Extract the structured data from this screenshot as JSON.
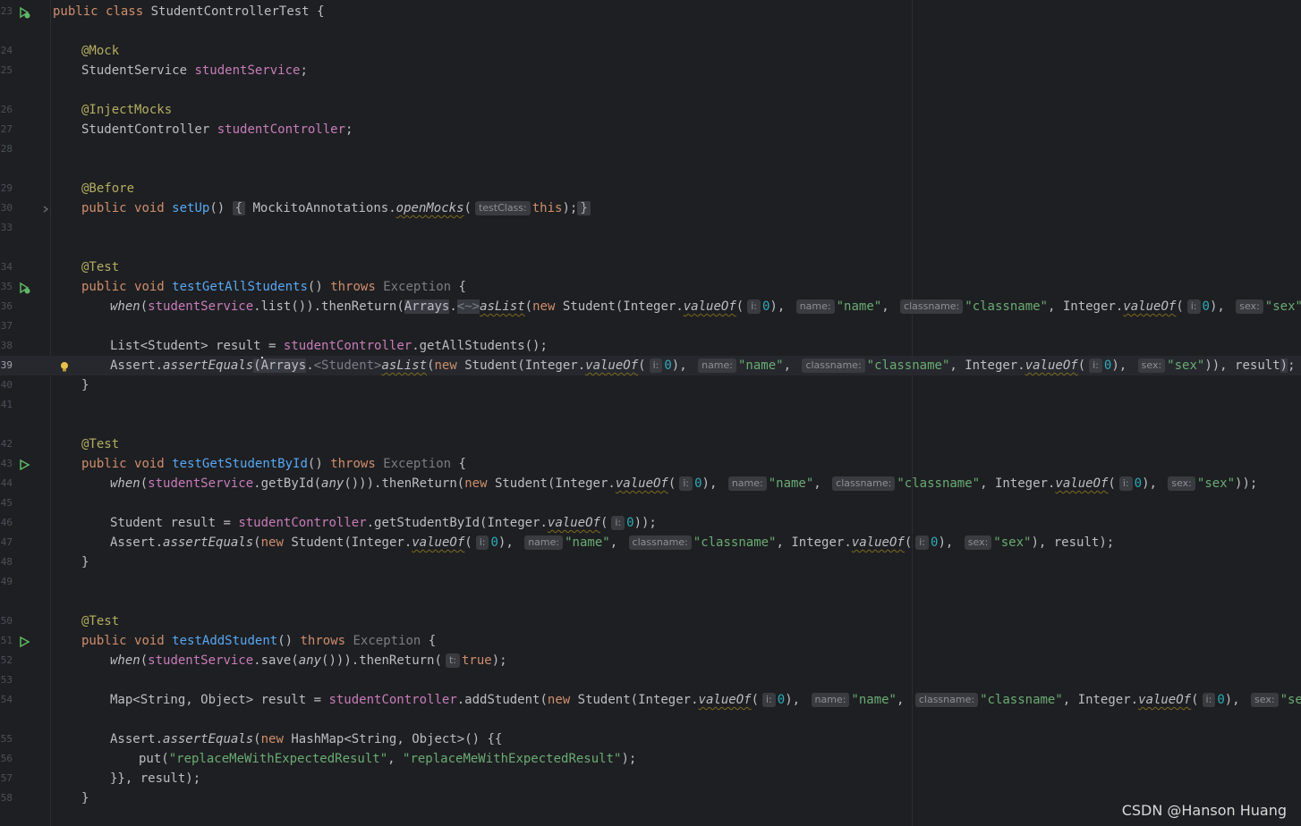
{
  "line_numbers": {
    "l23": "23",
    "l24": "24",
    "l25": "25",
    "l26": "26",
    "l27": "27",
    "l28": "28",
    "l29": "29",
    "l30": "30",
    "l33": "33",
    "l34": "34",
    "l35": "35",
    "l36": "36",
    "l37": "37",
    "l38": "38",
    "l39": "39",
    "l40": "40",
    "l41": "41",
    "l42": "42",
    "l43": "43",
    "l44": "44",
    "l45": "45",
    "l46": "46",
    "l47": "47",
    "l48": "48",
    "l49": "49",
    "l50": "50",
    "l51": "51",
    "l52": "52",
    "l53": "53",
    "l54": "54",
    "l55": "55",
    "l56": "56",
    "l57": "57",
    "l58": "58"
  },
  "words": {
    "public": "public",
    "class": "class",
    "void": "void",
    "new": "new",
    "throws": "throws",
    "this": "this",
    "true": "true",
    "zero": "0",
    "lbrace": "{",
    "rbrace": "}",
    "semi": ";",
    "StudentService": "StudentService",
    "StudentController": "StudentController",
    "studentService": "studentService",
    "studentController": "studentController",
    "Student": "Student",
    "Integer": "Integer",
    "valueOf": "valueOf",
    "Exception": "Exception",
    "Arrays": "Arrays",
    "asList": "asList",
    "Assert": "Assert",
    "assertEquals": "assertEquals",
    "when": "when",
    "any": "any",
    "result": "result",
    "thenReturn": "thenReturn",
    "str_name": "\"name\"",
    "str_classname": "\"classname\"",
    "str_sex": "\"sex\"",
    "str_replace": "\"replaceMeWithExpectedResult\""
  },
  "hints": {
    "i": "i:",
    "name": "name:",
    "classname": "classname:",
    "sex": "sex:",
    "t": "t:",
    "testClass": "testClass:"
  },
  "annotations": {
    "mock": "@Mock",
    "injectMocks": "@InjectMocks",
    "before": "@Before",
    "test": "@Test"
  },
  "names": {
    "class_name": "StudentControllerTest",
    "setUp": "setUp",
    "testGetAllStudents": "testGetAllStudents",
    "testGetStudentById": "testGetStudentById",
    "testAddStudent": "testAddStudent"
  },
  "misc": {
    "mockito": "MockitoAnnotations.",
    "openMocks": "openMocks",
    "generic_diamond": "<~>",
    "generic_student": "<Student>",
    "list_call": ".list()",
    "getAllStudents": ".getAllStudents();",
    "getById": ".getById(",
    "getStudentById": ".getStudentById(Integer.",
    "save": ".save(",
    "addStudent": ".addStudent(",
    "list_type": "List<Student> ",
    "map_type": "Map<String, Object> ",
    "hashmap": "HashMap<String, Object>() {{",
    "put": "put(",
    "close_map": "}}, result);"
  },
  "watermark": "CSDN @Hanson Huang"
}
